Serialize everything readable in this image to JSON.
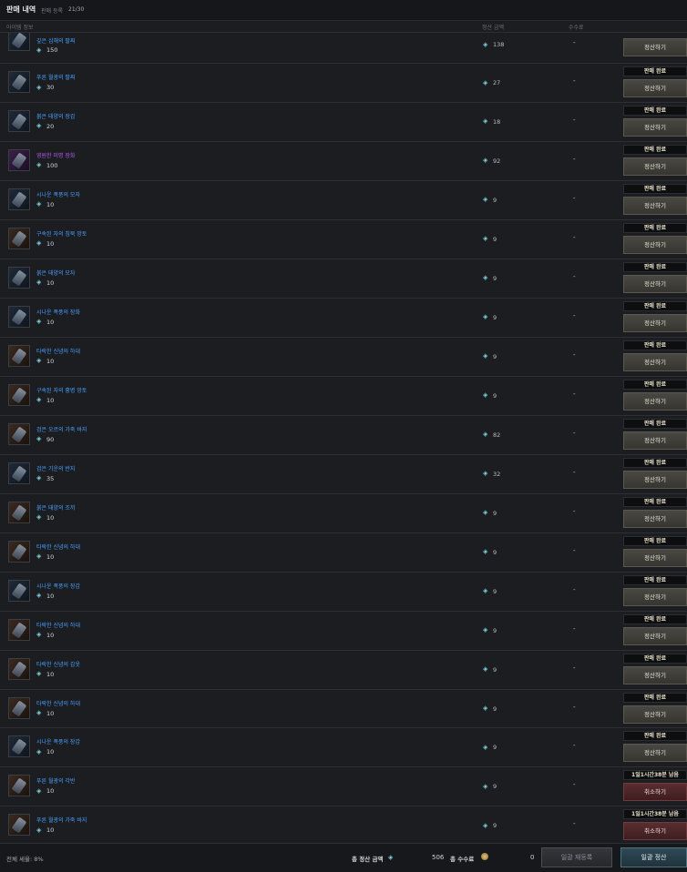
{
  "header": {
    "title": "판매 내역",
    "registered_label": "판매 등록",
    "registered_count": "21/30"
  },
  "columns": {
    "item": "아이템 정보",
    "settle": "정산 금액",
    "fee": "수수료"
  },
  "rows": [
    {
      "name": "깊은 심해의 팔찌",
      "price": "150",
      "settle": "138",
      "fee": "-",
      "status": "",
      "action": "정산하기",
      "icon": "bracelet-icon",
      "variant": "blue"
    },
    {
      "name": "푸른 월광의 팔찌",
      "price": "30",
      "settle": "27",
      "fee": "-",
      "status": "판매 완료",
      "action": "정산하기",
      "icon": "bracelet-icon",
      "variant": "blue"
    },
    {
      "name": "붉은 태양의 장갑",
      "price": "20",
      "settle": "18",
      "fee": "-",
      "status": "판매 완료",
      "action": "정산하기",
      "icon": "gloves-icon",
      "variant": "blue"
    },
    {
      "name": "영원한 미명 장화",
      "price": "100",
      "settle": "92",
      "fee": "-",
      "status": "판매 완료",
      "action": "정산하기",
      "icon": "boots-icon",
      "variant": "purple"
    },
    {
      "name": "시나운 폭풍의 모자",
      "price": "10",
      "settle": "9",
      "fee": "-",
      "status": "판매 완료",
      "action": "정산하기",
      "icon": "hat-icon",
      "variant": "blue"
    },
    {
      "name": "구속된 자의 침묵 망토",
      "price": "10",
      "settle": "9",
      "fee": "-",
      "status": "판매 완료",
      "action": "정산하기",
      "icon": "cloak-icon",
      "variant": "brown"
    },
    {
      "name": "붉은 태양의 모자",
      "price": "10",
      "settle": "9",
      "fee": "-",
      "status": "판매 완료",
      "action": "정산하기",
      "icon": "hat-icon",
      "variant": "blue"
    },
    {
      "name": "시나운 폭풍의 장화",
      "price": "10",
      "settle": "9",
      "fee": "-",
      "status": "판매 완료",
      "action": "정산하기",
      "icon": "boots-icon",
      "variant": "blue"
    },
    {
      "name": "타락한 신념의 하대",
      "price": "10",
      "settle": "9",
      "fee": "-",
      "status": "판매 완료",
      "action": "정산하기",
      "icon": "belt-icon",
      "variant": "brown"
    },
    {
      "name": "구속된 자의 흉병 망토",
      "price": "10",
      "settle": "9",
      "fee": "-",
      "status": "판매 완료",
      "action": "정산하기",
      "icon": "cloak-icon",
      "variant": "brown"
    },
    {
      "name": "검은 오르의 가죽 바지",
      "price": "90",
      "settle": "82",
      "fee": "-",
      "status": "판매 완료",
      "action": "정산하기",
      "icon": "pants-icon",
      "variant": "brown"
    },
    {
      "name": "검은 기운의 반지",
      "price": "35",
      "settle": "32",
      "fee": "-",
      "status": "판매 완료",
      "action": "정산하기",
      "icon": "ring-icon",
      "variant": "blue"
    },
    {
      "name": "붉은 태양의 조끼",
      "price": "10",
      "settle": "9",
      "fee": "-",
      "status": "판매 완료",
      "action": "정산하기",
      "icon": "vest-icon",
      "variant": "brown"
    },
    {
      "name": "타락한 신념의 하대",
      "price": "10",
      "settle": "9",
      "fee": "-",
      "status": "판매 완료",
      "action": "정산하기",
      "icon": "belt-icon",
      "variant": "brown"
    },
    {
      "name": "시나운 폭풍의 장갑",
      "price": "10",
      "settle": "9",
      "fee": "-",
      "status": "판매 완료",
      "action": "정산하기",
      "icon": "gloves-icon",
      "variant": "blue"
    },
    {
      "name": "타락한 신념의 하대",
      "price": "10",
      "settle": "9",
      "fee": "-",
      "status": "판매 완료",
      "action": "정산하기",
      "icon": "belt-icon",
      "variant": "brown"
    },
    {
      "name": "타락한 신념의 갑옷",
      "price": "10",
      "settle": "9",
      "fee": "-",
      "status": "판매 완료",
      "action": "정산하기",
      "icon": "armor-icon",
      "variant": "brown"
    },
    {
      "name": "타락한 신념의 하대",
      "price": "10",
      "settle": "9",
      "fee": "-",
      "status": "판매 완료",
      "action": "정산하기",
      "icon": "belt-icon",
      "variant": "brown"
    },
    {
      "name": "시나운 폭풍의 장갑",
      "price": "10",
      "settle": "9",
      "fee": "-",
      "status": "판매 완료",
      "action": "정산하기",
      "icon": "gloves-icon",
      "variant": "blue"
    },
    {
      "name": "푸른 월광의 각반",
      "price": "10",
      "settle": "9",
      "fee": "-",
      "status": "1일1시간38분 남음",
      "action": "취소하기",
      "icon": "greaves-icon",
      "variant": "brown"
    },
    {
      "name": "푸른 월광의 가죽 바지",
      "price": "10",
      "settle": "9",
      "fee": "-",
      "status": "1일1시간38분 남음",
      "action": "취소하기",
      "icon": "pants-icon",
      "variant": "brown"
    }
  ],
  "footer": {
    "rate_label": "전체 세율: 8%",
    "total_label": "총 정산 금액",
    "total_value": "506",
    "fee_label": "총 수수료",
    "fee_value": "0",
    "reregister_button": "일괄 재등록",
    "settle_all_button": "일괄 정산"
  },
  "colors": {
    "item_name_blue": "#4aa0ff",
    "item_name_purple": "#b75cf0",
    "gem": "#7fd8e6",
    "cancel": "#5a2d2f"
  }
}
